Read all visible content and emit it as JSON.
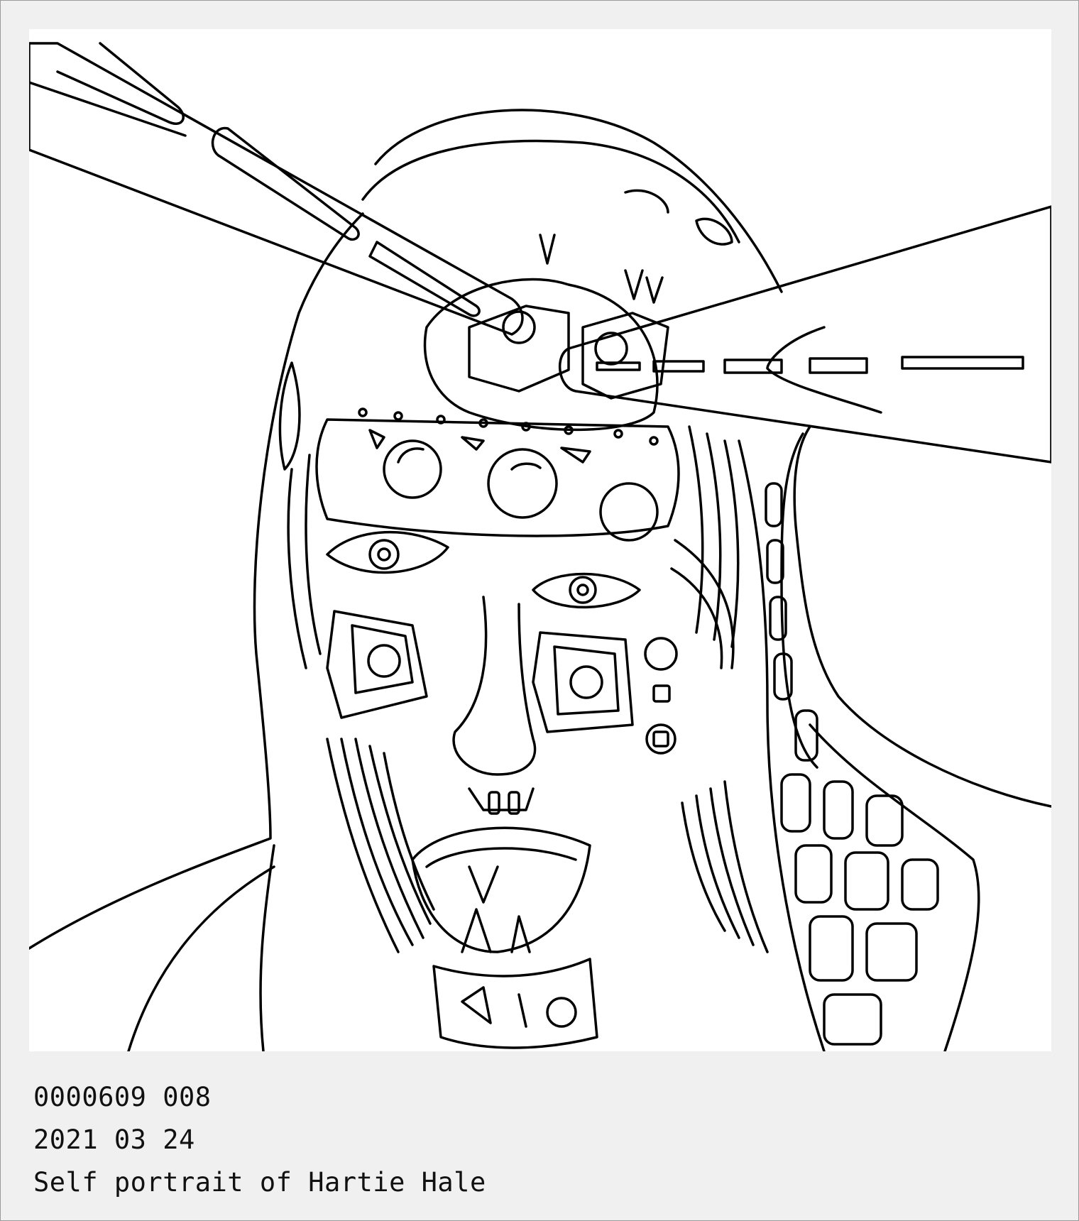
{
  "artwork": {
    "kind": "line-drawing",
    "subject": "portrait-face-with-beams"
  },
  "caption": {
    "id_line": "0000609 008",
    "date_line": "2021 03 24",
    "title_line": "Self portrait of Hartie Hale"
  },
  "colors": {
    "frame_background": "#f0f0f0",
    "frame_border": "#9a9a9a",
    "artwork_background": "#ffffff",
    "line_color": "#000000"
  }
}
